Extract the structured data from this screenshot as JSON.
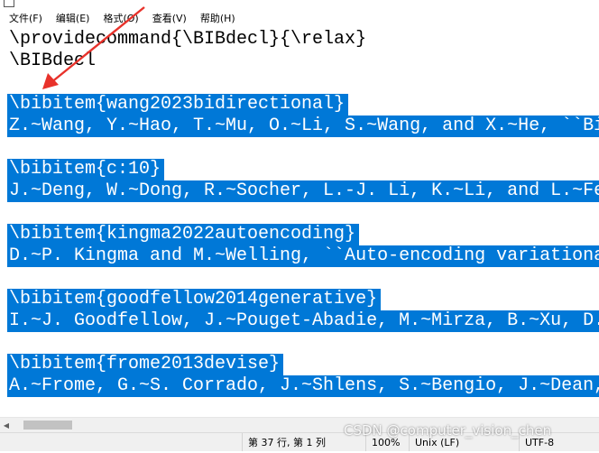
{
  "menu": {
    "file": "文件(F)",
    "edit": "编辑(E)",
    "format": "格式(O)",
    "view": "查看(V)",
    "help": "帮助(H)"
  },
  "editor": {
    "lines": [
      "\\providecommand{\\BIBdecl}{\\relax}",
      "\\BIBdecl",
      "",
      "\\bibitem{wang2023bidirectional}",
      "Z.~Wang, Y.~Hao, T.~Mu, O.~Li, S.~Wang, and X.~He, ``Bi",
      "",
      "\\bibitem{c:10}",
      "J.~Deng, W.~Dong, R.~Socher, L.-J. Li, K.~Li, and L.~Fe",
      "",
      "\\bibitem{kingma2022autoencoding}",
      "D.~P. Kingma and M.~Welling, ``Auto-encoding variationa",
      "",
      "\\bibitem{goodfellow2014generative}",
      "I.~J. Goodfellow, J.~Pouget-Abadie, M.~Mirza, B.~Xu, D.",
      "",
      "\\bibitem{frome2013devise}",
      "A.~Frome, G.~S. Corrado, J.~Shlens, S.~Bengio, J.~Dean,"
    ]
  },
  "status": {
    "position": "第 37 行, 第 1 列",
    "zoom": "100%",
    "line_ending": "Unix (LF)",
    "encoding": "UTF-8"
  },
  "watermark": "CSDN @computer_vision_chen",
  "colors": {
    "selection": "#0078d7",
    "annotation_arrow": "#e8322b"
  }
}
